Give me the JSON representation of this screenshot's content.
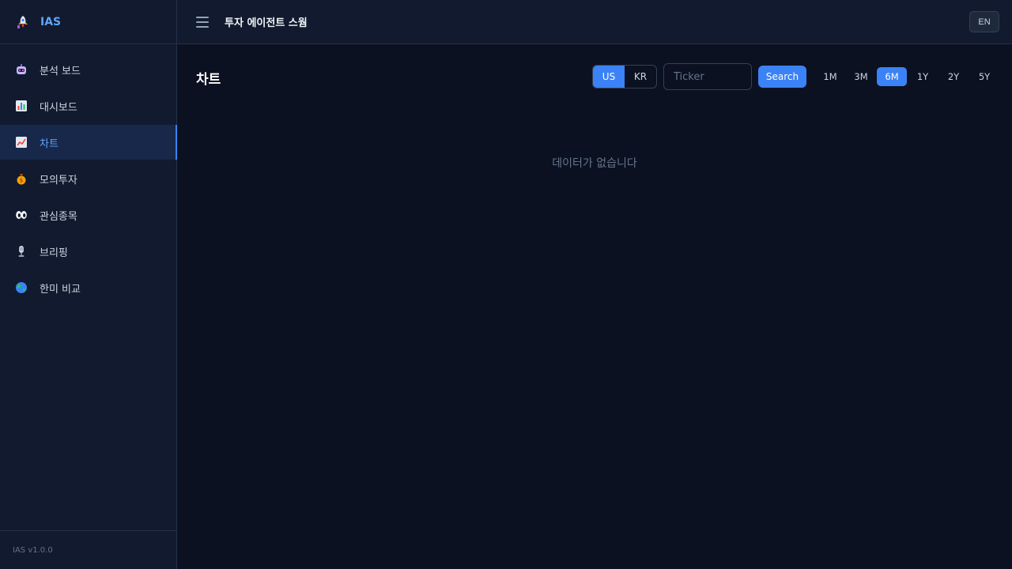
{
  "sidebar": {
    "brand": "IAS",
    "items": [
      {
        "icon": "robot-icon",
        "label": "분석 보드",
        "active": false
      },
      {
        "icon": "bar-chart-icon",
        "label": "대시보드",
        "active": false
      },
      {
        "icon": "line-chart-icon",
        "label": "차트",
        "active": true
      },
      {
        "icon": "money-bag-icon",
        "label": "모의투자",
        "active": false
      },
      {
        "icon": "eyes-icon",
        "label": "관심종목",
        "active": false
      },
      {
        "icon": "microphone-icon",
        "label": "브리핑",
        "active": false
      },
      {
        "icon": "globe-icon",
        "label": "한미 비교",
        "active": false
      }
    ],
    "version": "IAS v1.0.0"
  },
  "header": {
    "title": "투자 에이전트 스웜",
    "lang_button": "EN"
  },
  "main": {
    "title": "차트",
    "market": {
      "options": [
        "US",
        "KR"
      ],
      "selected": "US"
    },
    "ticker": {
      "placeholder": "Ticker",
      "value": ""
    },
    "search_label": "Search",
    "periods": {
      "options": [
        "1M",
        "3M",
        "6M",
        "1Y",
        "2Y",
        "5Y"
      ],
      "selected": "6M"
    },
    "empty_message": "데이터가 없습니다"
  },
  "colors": {
    "accent": "#3b82f6",
    "brand": "#60a5fa",
    "background": "#0b1120",
    "panel": "#111a2e"
  }
}
